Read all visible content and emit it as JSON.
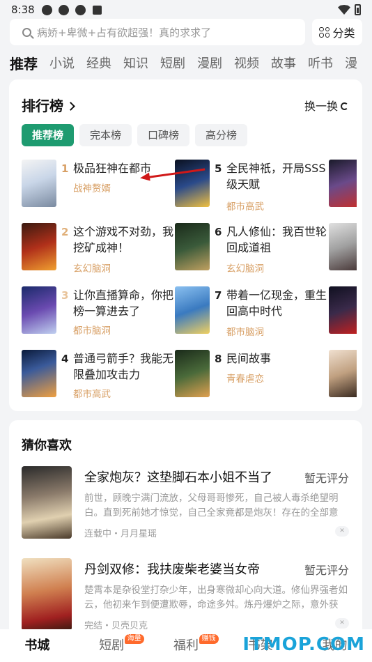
{
  "status_bar": {
    "time": "8:38"
  },
  "search": {
    "placeholder": "病娇+卑微+占有欲超强！真的求求了",
    "category_label": "分类"
  },
  "tabs": [
    "推荐",
    "小说",
    "经典",
    "知识",
    "短剧",
    "漫剧",
    "视频",
    "故事",
    "听书",
    "漫"
  ],
  "ranking": {
    "title": "排行榜",
    "refresh_label": "换一换",
    "filters": [
      "推荐榜",
      "完本榜",
      "口碑榜",
      "高分榜"
    ],
    "books": [
      {
        "rank": "1",
        "title": "极品狂神在都市",
        "tag": "战神赘婿",
        "rank_color": "#d8a066",
        "tag_color": "#d8a066"
      },
      {
        "rank": "2",
        "title": "这个游戏不对劲，我挖矿成神！",
        "tag": "玄幻脑洞",
        "rank_color": "#e0b07a",
        "tag_color": "#d8a066"
      },
      {
        "rank": "3",
        "title": "让你直播算命，你把榜一算进去了",
        "tag": "都市脑洞",
        "rank_color": "#e8c39a",
        "tag_color": "#d8a066"
      },
      {
        "rank": "4",
        "title": "普通弓箭手？我能无限叠加攻击力",
        "tag": "都市高武",
        "rank_color": "#222222",
        "tag_color": "#d8a066"
      },
      {
        "rank": "5",
        "title": "全民神祇，开局SSS级天赋",
        "tag": "都市高武",
        "rank_color": "#222222",
        "tag_color": "#d8a066"
      },
      {
        "rank": "6",
        "title": "凡人修仙：我百世轮回成道祖",
        "tag": "玄幻脑洞",
        "rank_color": "#222222",
        "tag_color": "#d8a066"
      },
      {
        "rank": "7",
        "title": "带着一亿现金，重生回高中时代",
        "tag": "都市脑洞",
        "rank_color": "#222222",
        "tag_color": "#d8a066"
      },
      {
        "rank": "8",
        "title": "民间故事",
        "tag": "青春虐恋",
        "rank_color": "#222222",
        "tag_color": "#d8a066"
      }
    ]
  },
  "guess": {
    "title": "猜你喜欢",
    "items": [
      {
        "title": "全家炮灰？这垫脚石本小姐不当了",
        "score": "暂无评分",
        "desc": "前世，顾晚宁满门流放，父母哥哥惨死，自己被人毒杀绝望明白。直到死前她才惊觉，自己全家竟都是炮灰！存在的全部意义…",
        "meta": "连载中・月月星瑶"
      },
      {
        "title": "丹剑双修：我扶废柴老婆当女帝",
        "score": "暂无评分",
        "desc": "楚霄本是杂役堂打杂少年，出身寒微却心向大道。修仙界强者如云，他初来乍到便遭欺辱，命途多舛。炼丹爆炉之际，意外获得…",
        "meta": "完结・贝壳贝克"
      }
    ]
  },
  "bottom_nav": [
    {
      "label": "书城",
      "badge": ""
    },
    {
      "label": "短剧",
      "badge": "海量"
    },
    {
      "label": "福利",
      "badge": "赚钱"
    },
    {
      "label": "书架",
      "badge": ""
    },
    {
      "label": "我的",
      "badge": ""
    }
  ],
  "watermark": "ITMOP.COM"
}
